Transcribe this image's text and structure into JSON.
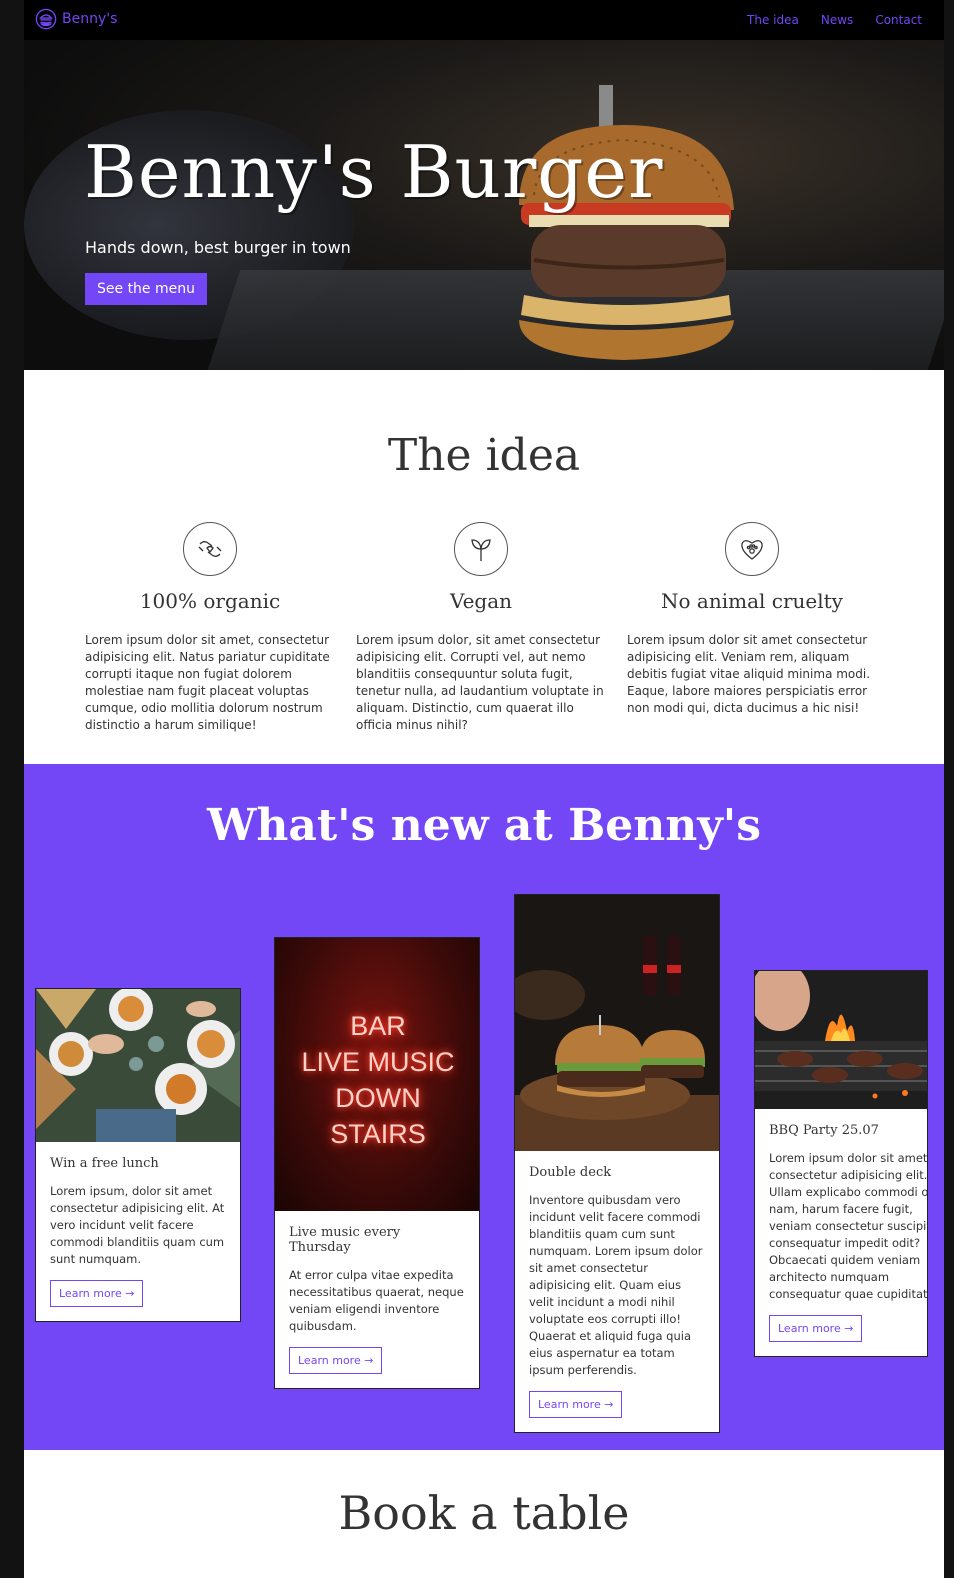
{
  "nav": {
    "brand": "Benny's",
    "links": [
      "The idea",
      "News",
      "Contact"
    ]
  },
  "hero": {
    "title": "Benny's Burger",
    "subtitle": "Hands down, best burger in town",
    "cta": "See the menu"
  },
  "idea": {
    "title": "The idea",
    "features": [
      {
        "icon": "care-hands-icon",
        "title": "100% organic",
        "text": "Lorem ipsum dolor sit amet, consectetur adipisicing elit. Natus pariatur cupiditate corrupti itaque non fugiat dolorem molestiae nam fugit placeat voluptas cumque, odio mollitia dolorum nostrum distinctio a harum similique!"
      },
      {
        "icon": "sprout-icon",
        "title": "Vegan",
        "text": "Lorem ipsum dolor, sit amet consectetur adipisicing elit. Corrupti vel, aut nemo blanditiis consequuntur soluta fugit, tenetur nulla, ad laudantium voluptate in aliquam. Distinctio, cum quaerat illo officia minus nihil?"
      },
      {
        "icon": "paw-heart-icon",
        "title": "No animal cruelty",
        "text": "Lorem ipsum dolor sit amet consectetur adipisicing elit. Veniam rem, aliquam debitis fugiat vitae aliquid minima modi. Eaque, labore maiores perspiciatis error non modi qui, dicta ducimus a hic nisi!"
      }
    ]
  },
  "news": {
    "title": "What's new at Benny's",
    "cards": [
      {
        "title": "Win a free lunch",
        "text": "Lorem ipsum, dolor sit amet consectetur adipisicing elit. At vero incidunt velit facere commodi blanditiis quam cum sunt numquam.",
        "button": "Learn more →"
      },
      {
        "title": "Live music every Thursday",
        "text": "At error culpa vitae expedita necessitatibus quaerat, neque veniam eligendi inventore quibusdam.",
        "button": "Learn more →",
        "sign": [
          "BAR",
          "LIVE MUSIC",
          "DOWN",
          "STAIRS"
        ]
      },
      {
        "title": "Double deck",
        "text": "Inventore quibusdam vero incidunt velit facere commodi blanditiis quam cum sunt numquam. Lorem ipsum dolor sit amet consectetur adipisicing elit. Quam eius velit incidunt a modi nihil voluptate eos corrupti illo! Quaerat et aliquid fuga quia eius aspernatur ea totam ipsum perferendis.",
        "button": "Learn more →"
      },
      {
        "title": "BBQ Party 25.07",
        "text": "Lorem ipsum dolor sit amet consectetur adipisicing elit. Ullam explicabo commodi odio nam, harum facere fugit, veniam consectetur suscipit consequatur impedit odit? Obcaecati quidem veniam architecto numquam consequatur quae cupiditate?",
        "button": "Learn more →"
      }
    ]
  },
  "book": {
    "title": "Book a table"
  },
  "colors": {
    "accent": "#7346f6",
    "nav_bg": "#000000",
    "text": "#333333"
  }
}
